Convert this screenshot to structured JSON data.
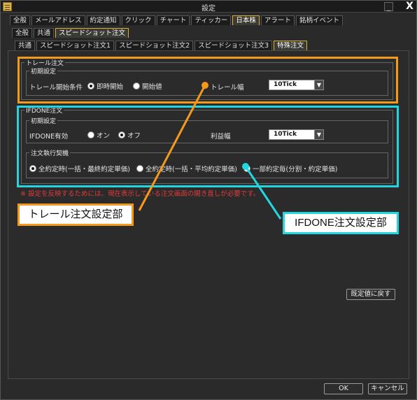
{
  "window": {
    "title": "設定",
    "minimize": "_",
    "close": "X"
  },
  "tabs_top": [
    "全般",
    "メールアドレス",
    "約定通知",
    "クリック",
    "チャート",
    "ティッカー",
    "日本株",
    "アラート",
    "銘柄イベント"
  ],
  "tabs_mid": [
    "全般",
    "共通",
    "スピードショット注文"
  ],
  "tabs_sub": [
    "共通",
    "スピードショット注文1",
    "スピードショット注文2",
    "スピードショット注文3",
    "特殊注文"
  ],
  "trail": {
    "legend": "トレール注文",
    "initial_legend": "初期設定",
    "start_label": "トレール開始条件",
    "opt_immediate": "即時開始",
    "opt_start_price": "開始値",
    "width_label": "トレール幅",
    "width_value": "10Tick"
  },
  "ifdone": {
    "legend": "IFDONE注文",
    "initial_legend": "初期設定",
    "enable_label": "IFDONE有効",
    "opt_on": "オン",
    "opt_off": "オフ",
    "profit_label": "利益幅",
    "profit_value": "10Tick",
    "exec_legend": "注文執行契機",
    "exec_opt1": "全約定時(一括・最終約定単価)",
    "exec_opt2": "全約定時(一括・平均約定単価)",
    "exec_opt3": "一部約定毎(分割・約定単価)"
  },
  "notice": "※ 設定を反映するためには、現在表示している注文画面の開き直しが必要です。",
  "buttons": {
    "restore": "既定値に戻す",
    "ok": "OK",
    "cancel": "キャンセル"
  },
  "callouts": {
    "trail": "トレール注文設定部",
    "ifdone": "IFDONE注文設定部"
  },
  "colors": {
    "trail_highlight": "#f39a1e",
    "ifdone_highlight": "#22d6df",
    "active_tab": "#d5b233",
    "notice": "#e23a3a"
  }
}
